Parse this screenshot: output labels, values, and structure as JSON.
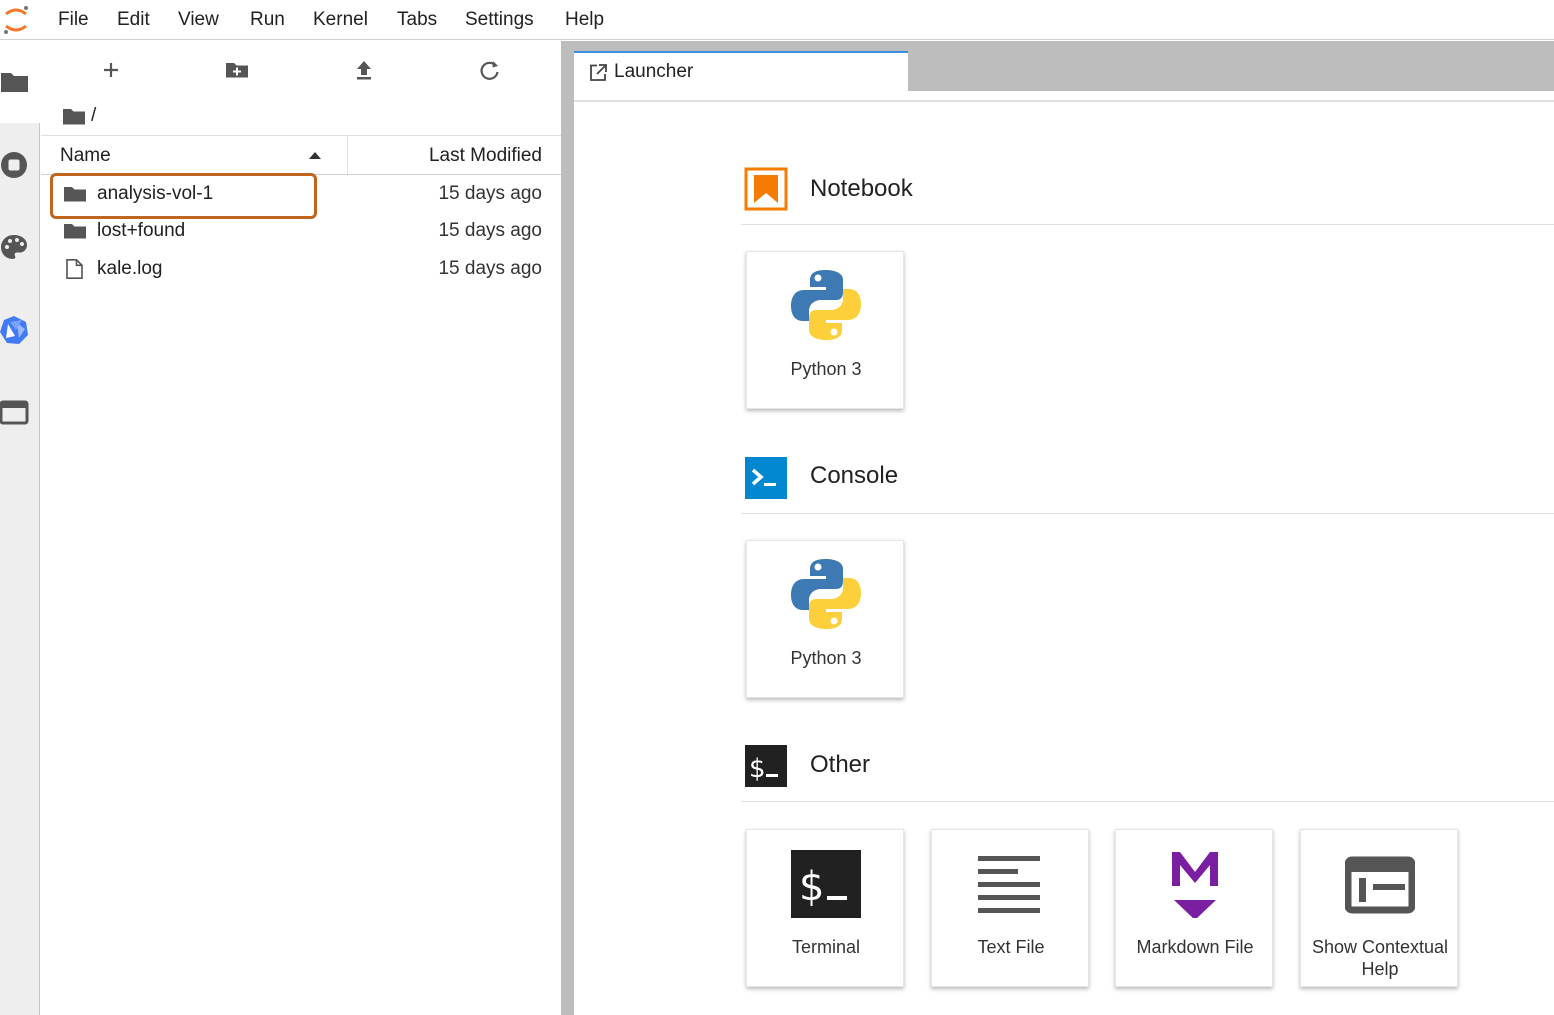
{
  "menubar": {
    "items": [
      "File",
      "Edit",
      "View",
      "Run",
      "Kernel",
      "Tabs",
      "Settings",
      "Help"
    ]
  },
  "activity_bar": {
    "icons": [
      "folder-icon",
      "running-stop-icon",
      "palette-icon",
      "kubeflow-icon",
      "tabs-icon"
    ]
  },
  "file_browser": {
    "toolbar": [
      "new-launcher-icon",
      "new-folder-icon",
      "upload-icon",
      "refresh-icon"
    ],
    "breadcrumb": "/",
    "columns": {
      "name": "Name",
      "modified": "Last Modified"
    },
    "rows": [
      {
        "name": "analysis-vol-1",
        "type": "folder",
        "modified": "15 days ago"
      },
      {
        "name": "lost+found",
        "type": "folder",
        "modified": "15 days ago"
      },
      {
        "name": "kale.log",
        "type": "file",
        "modified": "15 days ago"
      }
    ],
    "highlight_color": "#c0651e"
  },
  "tabs": [
    {
      "label": "Launcher"
    }
  ],
  "launcher": {
    "sections": [
      {
        "title": "Notebook",
        "cards": [
          {
            "label": "Python 3",
            "icon": "python-icon"
          }
        ]
      },
      {
        "title": "Console",
        "cards": [
          {
            "label": "Python 3",
            "icon": "python-icon"
          }
        ]
      },
      {
        "title": "Other",
        "cards": [
          {
            "label": "Terminal",
            "icon": "terminal-icon"
          },
          {
            "label": "Text File",
            "icon": "text-file-icon"
          },
          {
            "label": "Markdown File",
            "icon": "markdown-icon"
          },
          {
            "label": "Show Contextual Help",
            "icon": "contextual-help-icon"
          }
        ]
      }
    ]
  },
  "colors": {
    "notebook": "#f57c00",
    "console": "#0288d1",
    "terminal": "#212121",
    "markdown": "#7b1fa2"
  }
}
